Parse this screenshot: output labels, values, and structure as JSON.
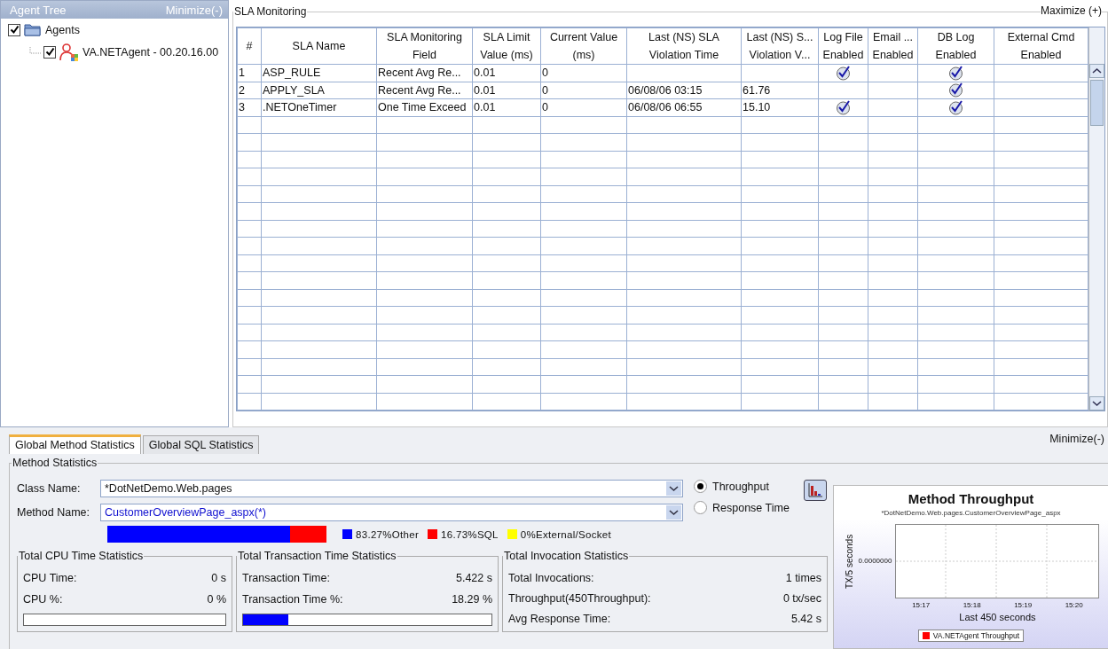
{
  "agent_tree": {
    "title": "Agent Tree",
    "minimize": "Minimize(-)",
    "items": [
      {
        "label": "Agents",
        "kind": "folder",
        "checked": true,
        "children": [
          {
            "label": "VA.NETAgent - 00.20.16.00",
            "kind": "agent",
            "checked": true
          }
        ]
      }
    ]
  },
  "sla_monitoring": {
    "title": "SLA Monitoring",
    "maximize": "Maximize (+)",
    "columns": [
      "#",
      "SLA Name",
      "SLA Monitoring\nField",
      "SLA Limit\nValue (ms)",
      "Current Value\n(ms)",
      "Last (NS) SLA\nViolation Time",
      "Last (NS) S...\nViolation V...",
      "Log File\nEnabled",
      "Email ...\nEnabled",
      "DB Log\nEnabled",
      "External Cmd\nEnabled"
    ],
    "rows": [
      {
        "number": "1",
        "name": "ASP_RULE",
        "field": "Recent Avg Re...",
        "limit": "0.01",
        "current": "0",
        "log_file": true,
        "email": false,
        "db_log": true,
        "external_cmd": false
      },
      {
        "number": "2",
        "name": "APPLY_SLA",
        "field": "Recent Avg Re...",
        "limit": "0.01",
        "current": "0",
        "violation_time": "06/08/06 03:15",
        "violation_value": "61.76",
        "log_file": false,
        "email": false,
        "db_log": true,
        "external_cmd": false
      },
      {
        "number": "3",
        "name": ".NETOneTimer",
        "field": "One Time Exceed",
        "limit": "0.01",
        "current": "0",
        "violation_time": "06/08/06 06:55",
        "violation_value": "15.10",
        "log_file": true,
        "email": false,
        "db_log": true,
        "external_cmd": false
      }
    ]
  },
  "tabs": [
    {
      "label": "Global Method Statistics",
      "selected": true
    },
    {
      "label": "Global SQL Statistics",
      "selected": false
    }
  ],
  "minimize": "Minimize(-)",
  "method_statistics": {
    "title": "Method Statistics",
    "class_name": {
      "label": "Class Name:",
      "value": "*DotNetDemo.Web.pages"
    },
    "method_name": {
      "label": "Method Name:",
      "value": "CustomerOverviewPage_aspx(*)"
    },
    "modes": [
      {
        "label": "Throughput",
        "selected": true
      },
      {
        "label": "Response Time",
        "selected": false
      }
    ],
    "breakdown": [
      {
        "label": "83.27%Other",
        "color": "#0000ff",
        "level": 0.8327
      },
      {
        "label": "16.73%SQL",
        "color": "#ff0000",
        "level": 0.1673
      },
      {
        "label": "0%External/Socket",
        "color": "#ffff00",
        "level": 0
      }
    ],
    "cpu": {
      "title": "Total CPU Time Statistics",
      "rows": [
        {
          "label": "CPU Time:",
          "value": "0 s"
        },
        {
          "label": "CPU %:",
          "value": "0 %"
        }
      ],
      "level": 0
    },
    "transaction": {
      "title": "Total Transaction Time Statistics",
      "rows": [
        {
          "label": "Transaction Time:",
          "value": "5.422 s"
        },
        {
          "label": "Transaction Time %:",
          "value": "18.29 %"
        }
      ],
      "level": 0.1829
    },
    "invocation": {
      "title": "Total Invocation Statistics",
      "rows": [
        {
          "label": "Total Invocations:",
          "value": "1 times"
        },
        {
          "label": "Throughput(450Throughput):",
          "value": "0 tx/sec"
        },
        {
          "label": "Avg Response Time:",
          "value": "5.42 s"
        }
      ]
    },
    "chart": {
      "title": "Method Throughput",
      "subtitle": "*DotNetDemo.Web.pages.CustomerOverviewPage_aspx",
      "ylabel": "TX/5 seconds",
      "ytick": "0.0000000",
      "xticks": [
        "15:17",
        "15:18",
        "15:19",
        "15:20"
      ],
      "xlabel": "Last 450 seconds",
      "legend": {
        "label": "VA.NETAgent Throughput",
        "color": "#ff0000"
      }
    }
  }
}
